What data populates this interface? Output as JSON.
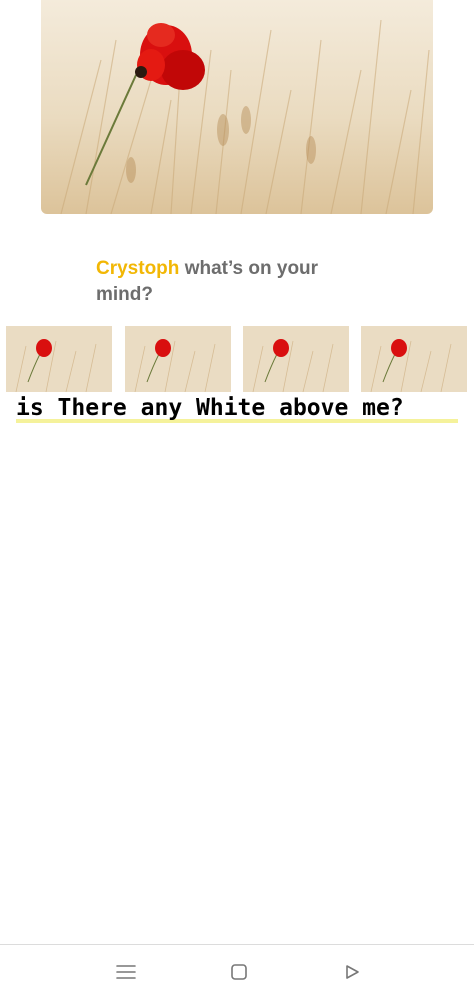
{
  "post": {
    "user_name": "Crystoph",
    "prompt_text": "what’s on your mind?"
  },
  "question": {
    "text": "is There any White above me?"
  },
  "images": {
    "hero": "poppy-field-image",
    "thumbnails": [
      "poppy-field-image",
      "poppy-field-image",
      "poppy-field-image",
      "poppy-field-image"
    ]
  },
  "nav": {
    "items": [
      "menu-icon",
      "home-square-icon",
      "back-triangle-icon"
    ]
  },
  "colors": {
    "name_accent": "#f2b705",
    "prompt_text": "#6d6d6d",
    "question_underline": "#f3f08a",
    "wheat_light": "#f2e6d0",
    "poppy_red": "#d90f0f"
  }
}
